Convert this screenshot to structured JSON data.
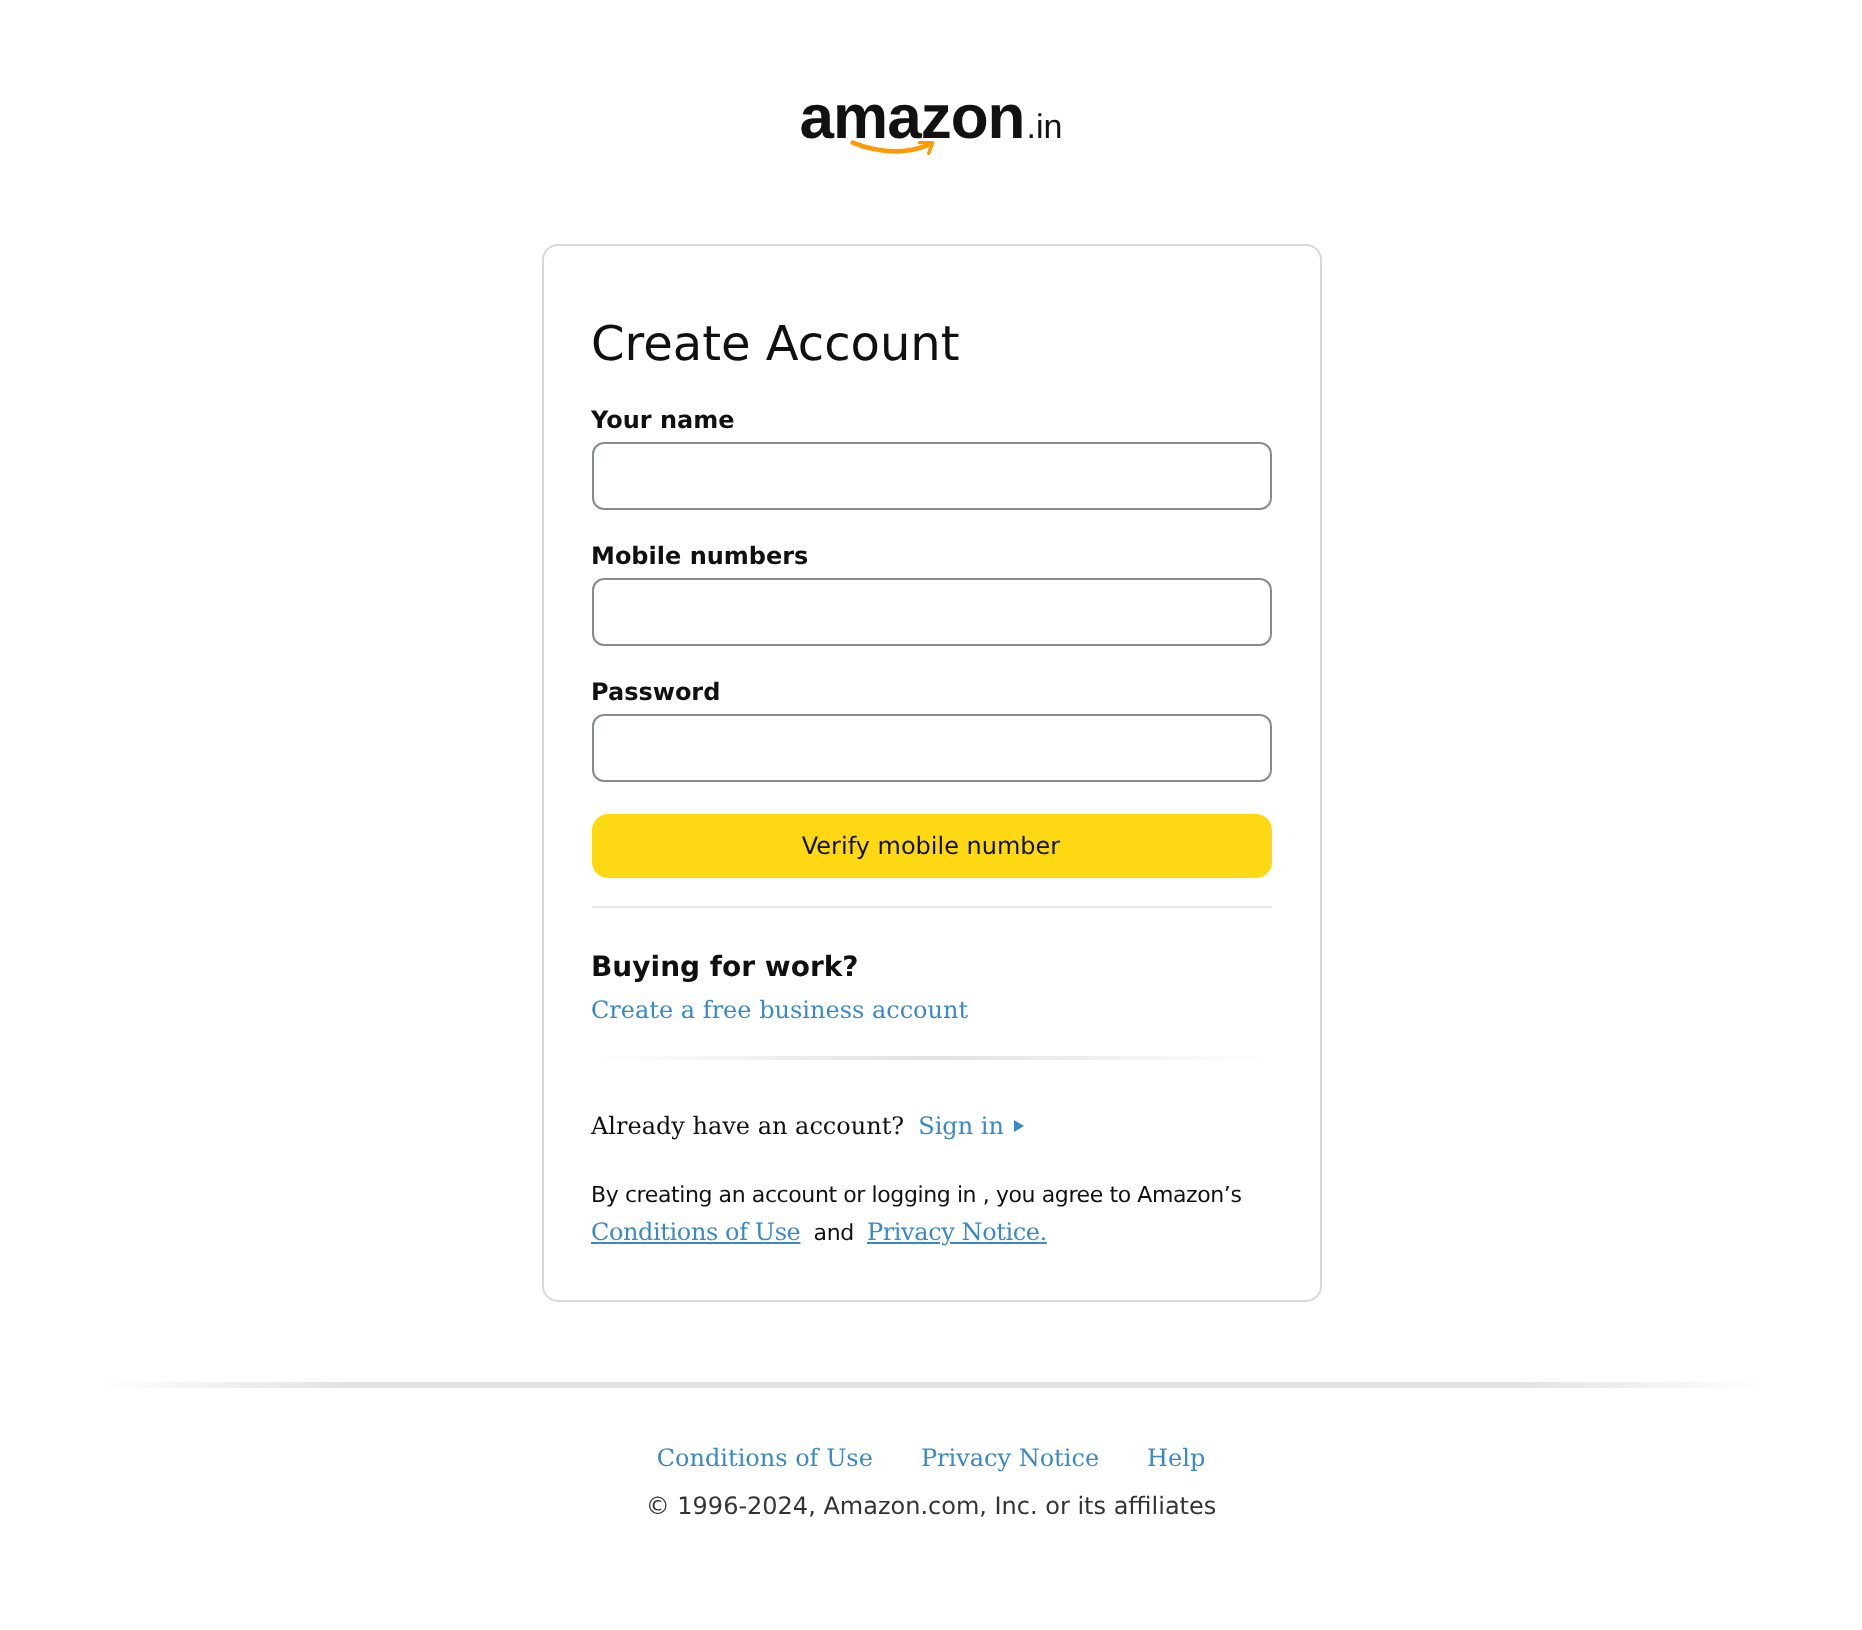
{
  "logo": {
    "name": "amazon",
    "suffix": ".in"
  },
  "form": {
    "title": "Create Account",
    "fields": [
      {
        "label": "Your name"
      },
      {
        "label": "Mobile numbers"
      },
      {
        "label": "Password"
      }
    ],
    "submit": "Verify mobile number"
  },
  "business": {
    "heading": "Buying for work?",
    "link": "Create a free business account"
  },
  "sign_in": {
    "prompt": "Already have an account?",
    "link": "Sign in"
  },
  "legal": {
    "text": "By creating an account or logging in , you agree to Amazon’s",
    "links": [
      "Conditions of Use",
      "Privacy Notice."
    ],
    "joiner": "and"
  },
  "footer": {
    "links": [
      "Conditions of Use",
      "Privacy Notice",
      "Help"
    ],
    "copyright": "© 1996-2024, Amazon.com, Inc. or its affiliates"
  }
}
